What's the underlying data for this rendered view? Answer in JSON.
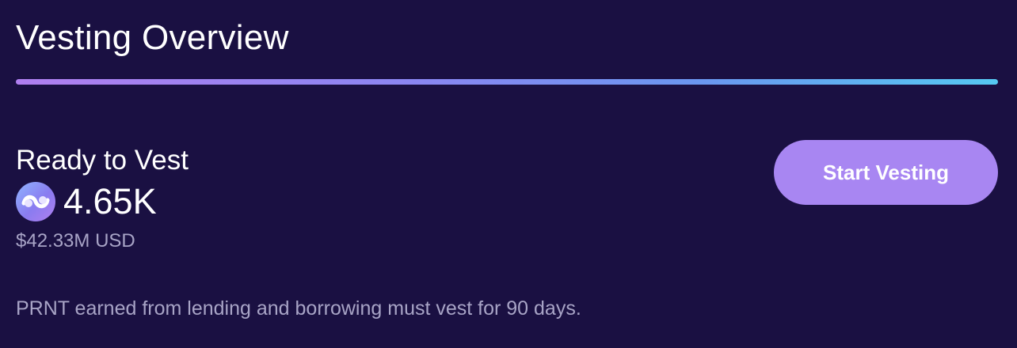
{
  "header": {
    "title": "Vesting Overview"
  },
  "vest": {
    "label": "Ready to Vest",
    "token_icon": "prnt-token-icon",
    "amount": "4.65K",
    "usd_value": "$42.33M USD",
    "button_label": "Start Vesting",
    "note": "PRNT earned from lending and borrowing must vest for 90 days."
  },
  "colors": {
    "background": "#1a1042",
    "button": "#a886f2",
    "muted_text": "#a8a4c6",
    "divider_start": "#b07ff0",
    "divider_end": "#56c9f2"
  }
}
